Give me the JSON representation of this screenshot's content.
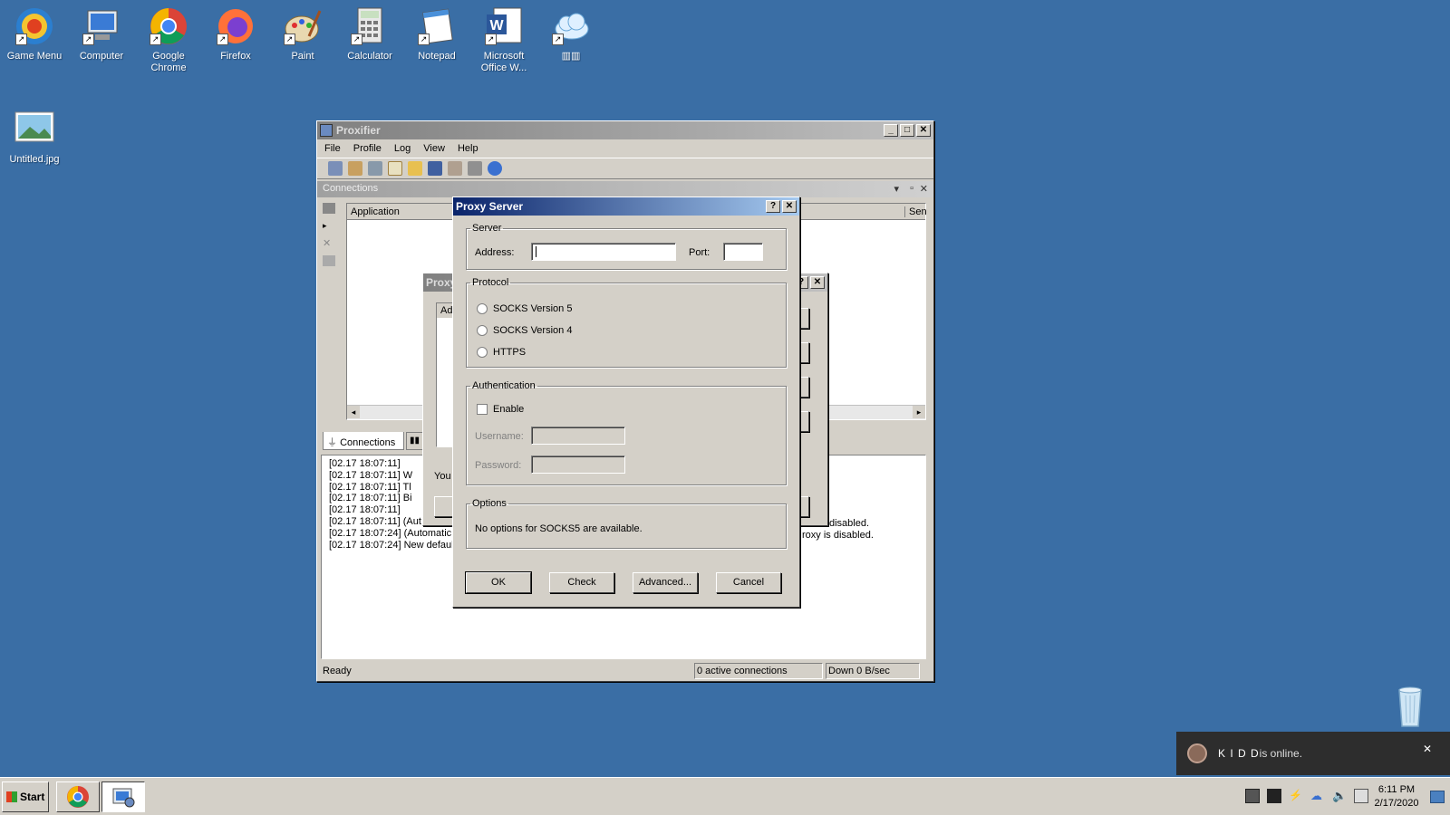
{
  "desktop": {
    "icons": [
      {
        "name": "game-menu-icon",
        "label": "Game Menu"
      },
      {
        "name": "computer-icon",
        "label": "Computer"
      },
      {
        "name": "chrome-icon",
        "label": "Google Chrome"
      },
      {
        "name": "firefox-icon",
        "label": "Firefox"
      },
      {
        "name": "paint-icon",
        "label": "Paint"
      },
      {
        "name": "calculator-icon",
        "label": "Calculator"
      },
      {
        "name": "notepad-icon",
        "label": "Notepad"
      },
      {
        "name": "word-icon",
        "label": "Microsoft Office W..."
      },
      {
        "name": "cloud-icon",
        "label": "▥▥"
      },
      {
        "name": "image-file-icon",
        "label": "Untitled.jpg"
      }
    ]
  },
  "proxifier": {
    "title": "Proxifier",
    "menu": [
      "File",
      "Profile",
      "Log",
      "View",
      "Help"
    ],
    "connections_panel_title": "Connections",
    "columns": {
      "application": "Application",
      "sent": "Sen"
    },
    "tabs": {
      "connections": "Connections"
    },
    "log": [
      "[02.17 18:07:11]",
      "[02.17 18:07:11]     W",
      "[02.17 18:07:11]     Tl",
      "[02.17 18:07:11]     Bi",
      "[02.17 18:07:11]",
      "[02.17 18:07:11] (Aut",
      "[02.17 18:07:24] (Automatic I",
      "[02.17 18:07:24] New defaul"
    ],
    "log_right": [
      "disabled.",
      "roxy is disabled."
    ],
    "status": {
      "ready": "Ready",
      "connections": "0 active connections",
      "down": "Down 0 B/sec"
    }
  },
  "proxies_dialog": {
    "title_partial": "Proxy",
    "col_partial": "Ad",
    "text_partial": "You"
  },
  "proxy_server_dialog": {
    "title": "Proxy Server",
    "help_btn": "?",
    "close_btn": "✕",
    "server_group": "Server",
    "address_label": "Address:",
    "address_value": "",
    "port_label": "Port:",
    "port_value": "",
    "protocol_group": "Protocol",
    "protocols": [
      "SOCKS Version 5",
      "SOCKS Version 4",
      "HTTPS"
    ],
    "auth_group": "Authentication",
    "enable_label": "Enable",
    "username_label": "Username:",
    "password_label": "Password:",
    "options_group": "Options",
    "options_text": "No options for SOCKS5 are available.",
    "buttons": {
      "ok": "OK",
      "check": "Check",
      "advanced": "Advanced...",
      "cancel": "Cancel"
    }
  },
  "notification": {
    "name": "K I D D",
    "text": " is online.",
    "close": "✕"
  },
  "taskbar": {
    "start": "Start",
    "time": "6:11 PM",
    "date": "2/17/2020"
  }
}
